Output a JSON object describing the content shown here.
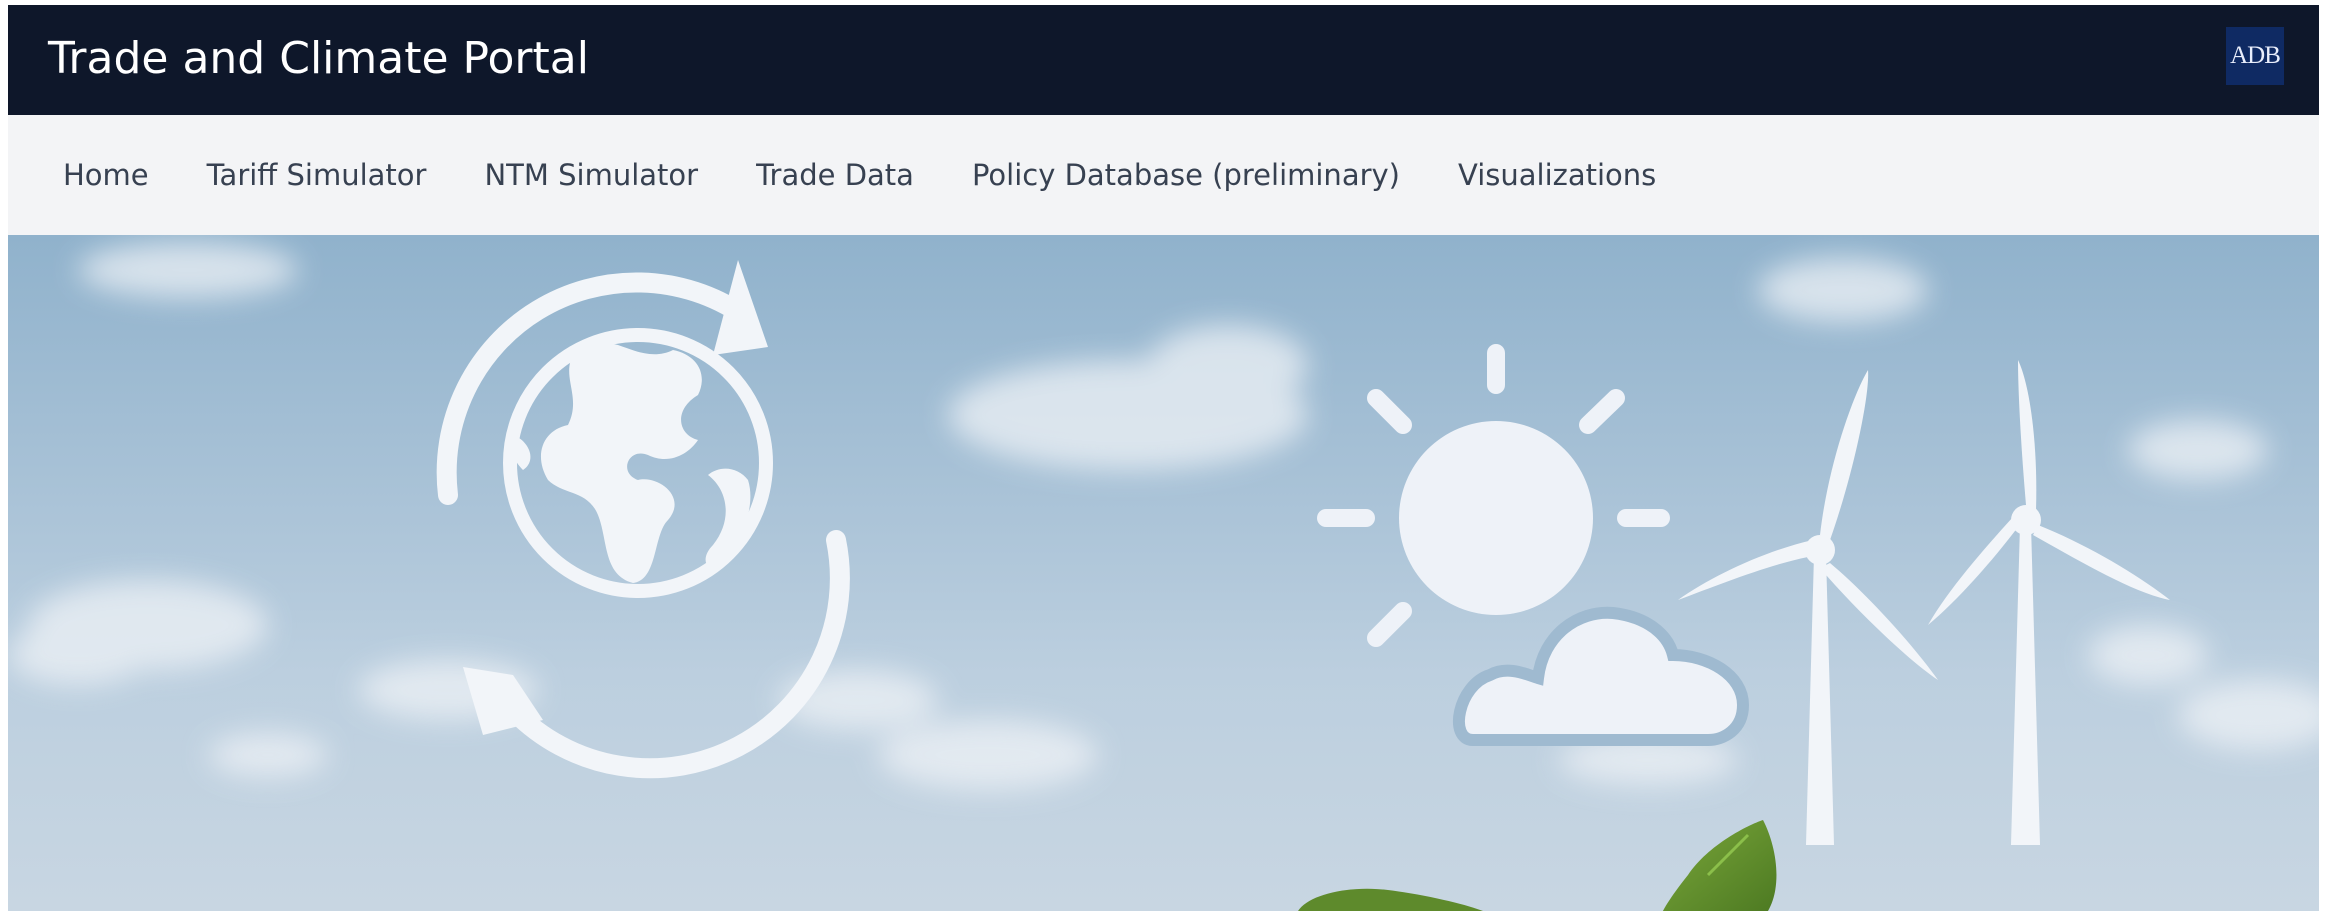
{
  "header": {
    "title": "Trade and Climate Portal",
    "logo_text": "ADB",
    "background_color": "#0e172a",
    "logo_color": "#0f2a63"
  },
  "nav": {
    "items": [
      {
        "label": "Home"
      },
      {
        "label": "Tariff Simulator"
      },
      {
        "label": "NTM Simulator"
      },
      {
        "label": "Trade Data"
      },
      {
        "label": "Policy Database (preliminary)"
      },
      {
        "label": "Visualizations"
      }
    ]
  },
  "hero": {
    "icons": [
      "globe-recycle-icon",
      "sun-icon",
      "cloud-icon",
      "wind-turbine-icon",
      "leaf-icon"
    ],
    "sky_color": "#9fbad0",
    "icon_color": "#f2f5f9",
    "leaf_color": "#5e8a2c"
  }
}
